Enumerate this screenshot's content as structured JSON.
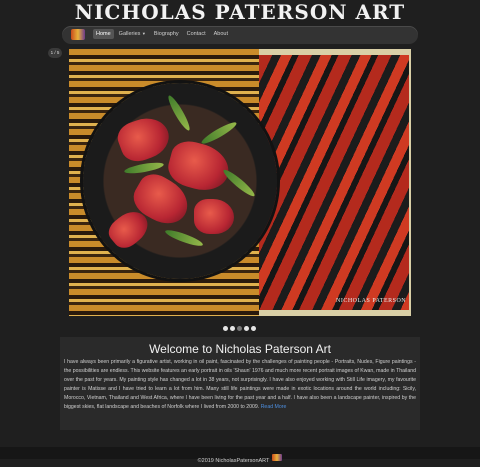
{
  "header": {
    "title": "Nicholas Paterson Art"
  },
  "nav": {
    "logo_icon": "site-logo",
    "items": [
      {
        "label": "Home",
        "active": true
      },
      {
        "label": "Galleries",
        "dropdown": true
      },
      {
        "label": "Biography"
      },
      {
        "label": "Contact"
      },
      {
        "label": "About"
      }
    ]
  },
  "carousel": {
    "counter": "1 / 5",
    "image_signature": "NICHOLAS PATERSON",
    "indicators": 5,
    "active_index": 2
  },
  "welcome": {
    "heading": "Welcome to Nicholas Paterson Art",
    "body": "I have always been primarily a figurative artist, working in oil paint, fascinated by the challenges of painting people - Portraits, Nudes, Figure paintings - the possibilities are endless. This website features an early portrait in oils 'Shaun' 1976 and much more recent portrait images of Kwan, made in Thailand over the past for years. My painting style has changed a lot in 38 years, not surprisingly. I have also enjoyed working with Still Life imagery, my favourite painter is Matisse and I have tried to learn a lot from him. Many still life paintings were made in exotic locations around the world including: Sicily, Morocco, Vietnam, Thailand and West Africa, where I have been living for the past year and a half. I have also been a landscape painter, inspired by the biggest skies, flat landscape and beaches of Norfolk where I lived from 2000 to 2009.",
    "read_more": "Read More"
  },
  "footer": {
    "text": "©2019 NicholasPatersonART"
  }
}
